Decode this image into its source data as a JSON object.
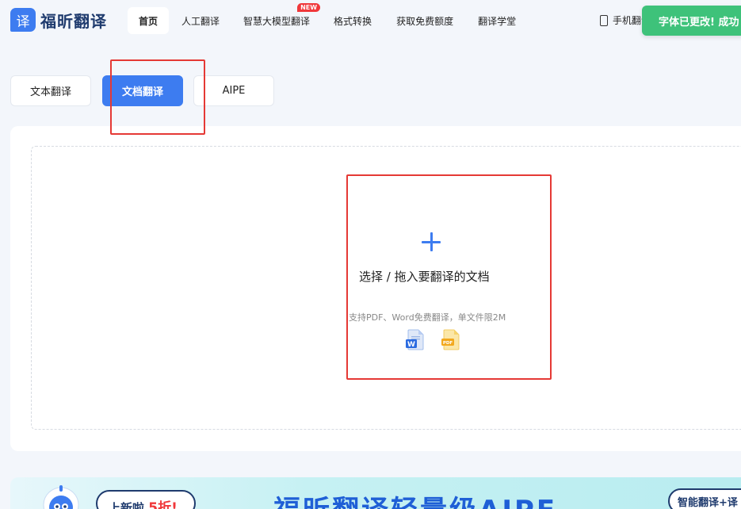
{
  "header": {
    "logo_char": "译",
    "logo_text": "福昕翻译",
    "nav": [
      {
        "label": "首页",
        "active": true
      },
      {
        "label": "人工翻译"
      },
      {
        "label": "智慧大模型翻译",
        "badge": "NEW"
      },
      {
        "label": "格式转换"
      },
      {
        "label": "获取免费额度"
      },
      {
        "label": "翻译学堂"
      }
    ],
    "mobile_label": "手机翻译"
  },
  "toast": {
    "text": "字体已更改! 成功"
  },
  "tabs": [
    {
      "label": "文本翻译"
    },
    {
      "label": "文档翻译",
      "active": true
    },
    {
      "label": "AIPE"
    }
  ],
  "upload": {
    "title": "选择 / 拖入要翻译的文档",
    "hint": "支持PDF、Word免费翻译，单文件限2M",
    "file_icons": [
      "word-icon",
      "pdf-icon"
    ],
    "word_letter": "W",
    "pdf_label": "PDF"
  },
  "banner": {
    "sale_prefix": "上新啦",
    "sale_highlight": "5折!",
    "title": "福昕翻译轻量级AIPE",
    "right_pill": "智能翻译+译"
  },
  "colors": {
    "accent": "#3d7cf0",
    "toast": "#3ec27a",
    "annotation": "#e53935",
    "badge": "#f0383b"
  }
}
